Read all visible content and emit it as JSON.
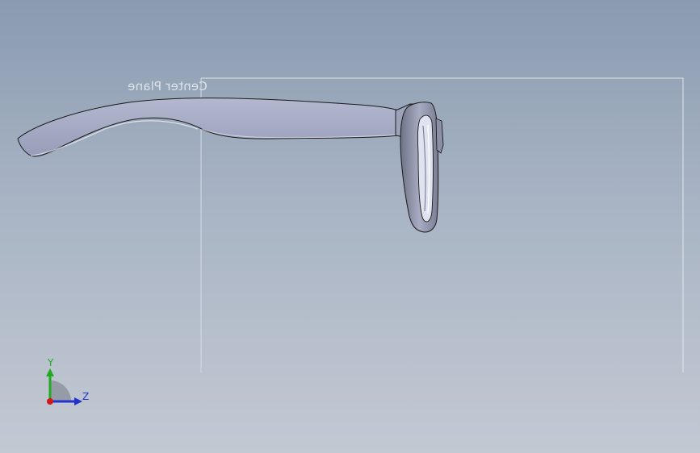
{
  "viewport": {
    "background_top": "#8a9bb0",
    "background_bottom": "#c3c9d3"
  },
  "reference_plane": {
    "label": "Center Plane",
    "color": "#dde3ea"
  },
  "model": {
    "part": "eyeglasses frame with temple arm",
    "view": "right side",
    "body_color": "#a4a9c2",
    "edge_color": "#1a1a1a"
  },
  "triad": {
    "y_label": "Y",
    "z_label": "Z",
    "y_color": "#1faa1f",
    "z_color": "#2233cc",
    "origin_color": "#d01818"
  }
}
